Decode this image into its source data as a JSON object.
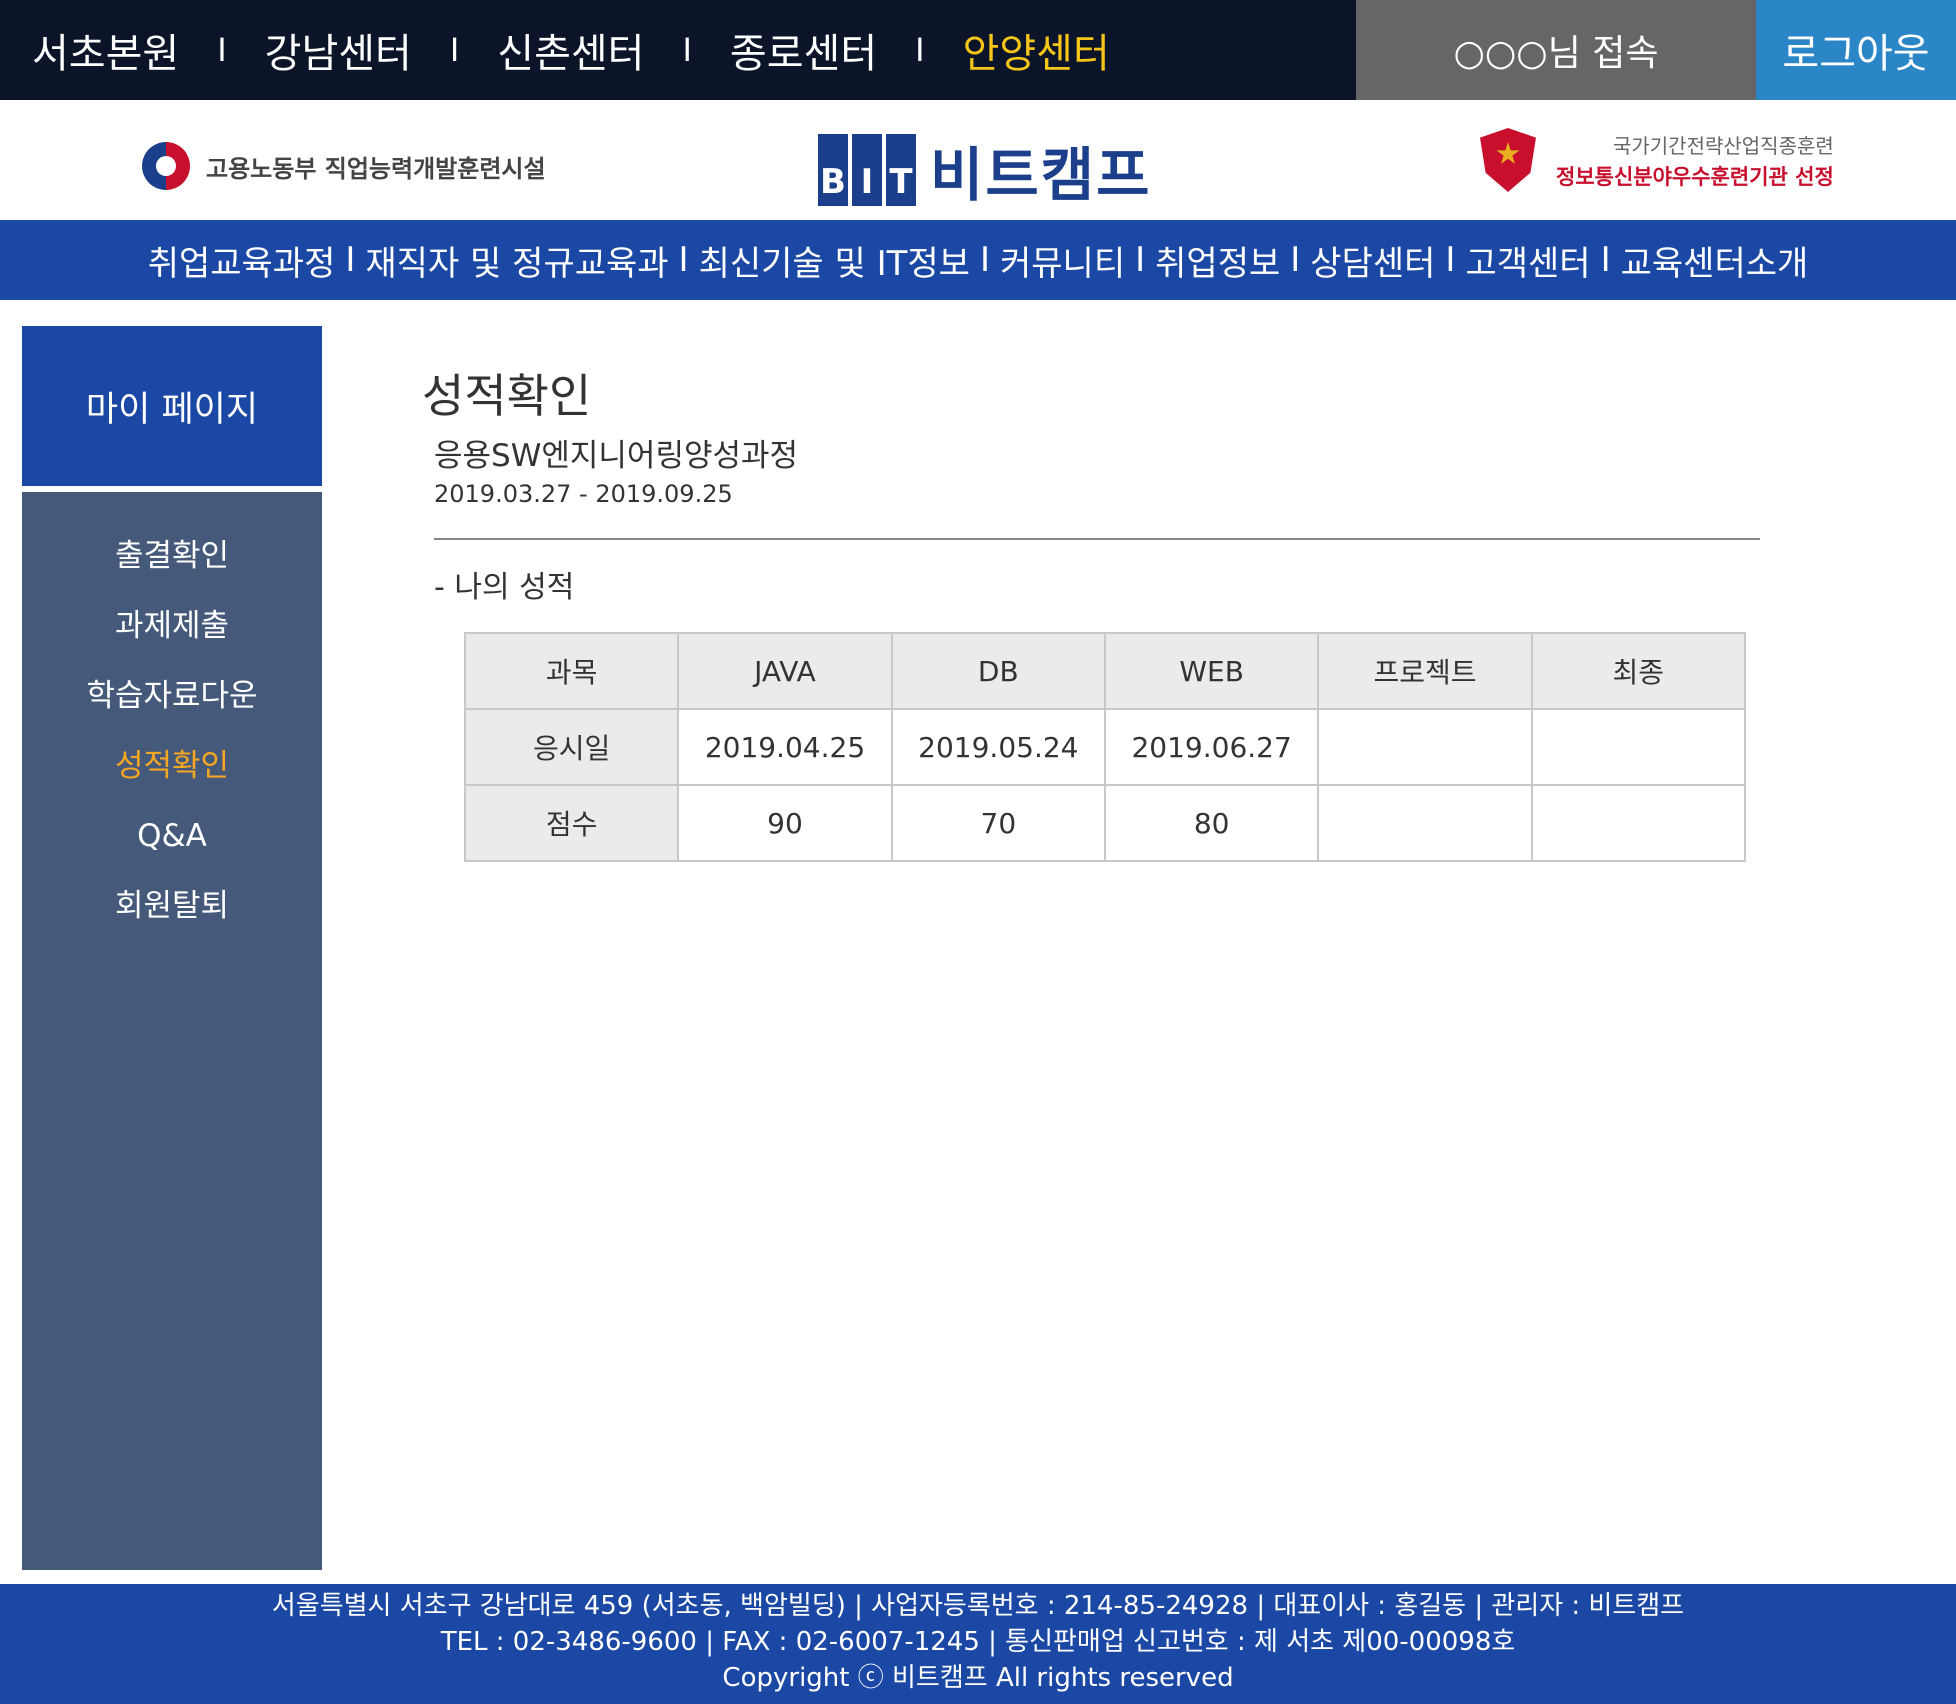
{
  "top_bar": {
    "centers": [
      "서초본원",
      "강남센터",
      "신촌센터",
      "종로센터",
      "안양센터"
    ],
    "separator": "I",
    "active_center": "안양센터",
    "user_text": "○○○님 접속",
    "logout_label": "로그아웃"
  },
  "logos": {
    "ministry_text": "고용노동부  직업능력개발훈련시설",
    "bit_letters": [
      "B",
      "I",
      "T"
    ],
    "bit_name": "비트캠프",
    "award_line1": "국가기간전략산업직종훈련",
    "award_line2": "정보통신분야우수훈련기관 선정"
  },
  "main_nav": {
    "items": [
      "취업교육과정",
      "재직자 및 정규교육과",
      "최신기술 및 IT정보",
      "커뮤니티",
      "취업정보",
      "상담센터",
      "고객센터",
      "교육센터소개"
    ],
    "separator": "I"
  },
  "sidebar": {
    "title": "마이 페이지",
    "items": [
      "출결확인",
      "과제제출",
      "학습자료다운",
      "성적확인",
      "Q&A",
      "회원탈퇴"
    ],
    "active": "성적확인"
  },
  "content": {
    "title": "성적확인",
    "course": "응용SW엔지니어링양성과정",
    "period": "2019.03.27 - 2019.09.25",
    "section": "- 나의 성적",
    "table": {
      "headers": [
        "과목",
        "JAVA",
        "DB",
        "WEB",
        "프로젝트",
        "최종"
      ],
      "rows": [
        [
          "응시일",
          "2019.04.25",
          "2019.05.24",
          "2019.06.27",
          "",
          ""
        ],
        [
          "점수",
          "90",
          "70",
          "80",
          "",
          ""
        ]
      ]
    }
  },
  "footer": {
    "line1": "서울특별시 서초구 강남대로 459 (서초동, 백암빌딩) | 사업자등록번호 : 214-85-24928 | 대표이사 : 홍길동 | 관리자 : 비트캠프",
    "line2": "TEL : 02-3486-9600 | FAX : 02-6007-1245 | 통신판매업 신고번호 : 제 서초 제00-00098호",
    "line3": "Copyright ⓒ 비트캠프 All rights reserved"
  },
  "colors": {
    "top_bar_bg": "#0b1428",
    "active_center": "#f5c518",
    "user_box_bg": "#666666",
    "logout_bg": "#2a86c7",
    "brand_blue": "#1b48a4",
    "sidebar_bg": "#455a7a",
    "sidebar_active": "#f5a623"
  }
}
